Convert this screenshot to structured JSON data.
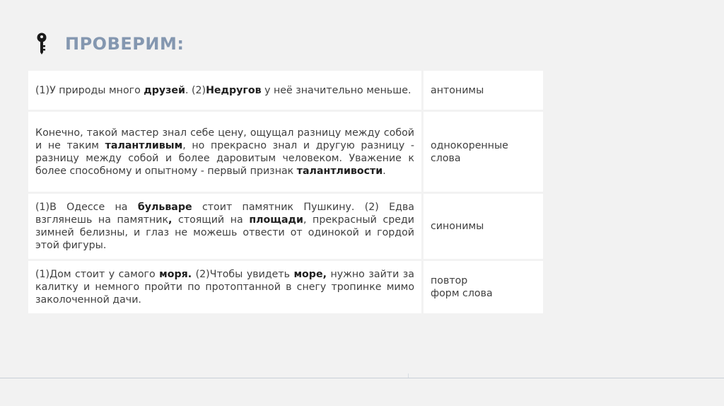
{
  "slide": {
    "title": "ПРОВЕРИМ:",
    "icon": "key-icon",
    "accent_color": "#8497b0"
  },
  "rows": [
    {
      "segments": [
        {
          "text": "(1)У природы много ",
          "bold": false
        },
        {
          "text": "друзей",
          "bold": true
        },
        {
          "text": ". (2)",
          "bold": false
        },
        {
          "text": "Недругов",
          "bold": true
        },
        {
          "text": " у неё значительно меньше.",
          "bold": false
        }
      ],
      "category": [
        "антонимы"
      ]
    },
    {
      "segments": [
        {
          "text": "Конечно, такой мастер знал себе цену, ощущал разницу между собой и не таким ",
          "bold": false
        },
        {
          "text": "талантливым",
          "bold": true
        },
        {
          "text": ", но прекрасно знал и другую разницу - разницу между собой и более даровитым человеком. Уважение к более способному и опытному - первый признак ",
          "bold": false
        },
        {
          "text": "талантливости",
          "bold": true
        },
        {
          "text": ".",
          "bold": false
        }
      ],
      "category": [
        "однокоренные",
        "слова"
      ]
    },
    {
      "segments": [
        {
          "text": "(1)В Одессе на ",
          "bold": false
        },
        {
          "text": "бульваре",
          "bold": true
        },
        {
          "text": " стоит памятник Пушкину. (2) Едва взглянешь на памятник",
          "bold": false
        },
        {
          "text": ",",
          "bold": true
        },
        {
          "text": " стоящий на ",
          "bold": false
        },
        {
          "text": "площади",
          "bold": true
        },
        {
          "text": ", прекрасный среди зимней белизны, и глаз не можешь отвести от одинокой и гордой этой фигуры.",
          "bold": false
        }
      ],
      "category": [
        "синонимы"
      ]
    },
    {
      "segments": [
        {
          "text": "(1)Дом стоит у самого ",
          "bold": false
        },
        {
          "text": "моря.",
          "bold": true
        },
        {
          "text": " (2)Чтобы увидеть ",
          "bold": false
        },
        {
          "text": "море,",
          "bold": true
        },
        {
          "text": " нужно зайти за калитку и немного пройти по протоптанной в снегу тропинке мимо заколоченной дачи.",
          "bold": false
        }
      ],
      "category": [
        "повтор",
        "форм слова"
      ]
    }
  ]
}
